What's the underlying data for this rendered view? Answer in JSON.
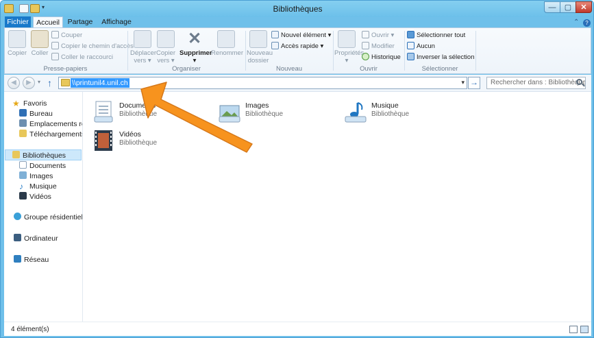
{
  "window": {
    "title": "Bibliothèques",
    "controls": {
      "minimize": "—",
      "maximize": "▢",
      "close": "✕"
    }
  },
  "ribbon": {
    "tabs": [
      {
        "label": "Fichier"
      },
      {
        "label": "Accueil"
      },
      {
        "label": "Partage"
      },
      {
        "label": "Affichage"
      }
    ],
    "groups": {
      "clipboard": {
        "label": "Presse-papiers",
        "copy": "Copier",
        "paste": "Coller",
        "cut": "Couper",
        "copy_path": "Copier le chemin d'accès",
        "paste_shortcut": "Coller le raccourci"
      },
      "organize": {
        "label": "Organiser",
        "move_to_l1": "Déplacer",
        "move_to_l2": "vers ▾",
        "copy_to_l1": "Copier",
        "copy_to_l2": "vers ▾",
        "delete": "Supprimer",
        "delete_arrow": "▾",
        "rename": "Renommer"
      },
      "new": {
        "label": "Nouveau",
        "new_folder_l1": "Nouveau",
        "new_folder_l2": "dossier",
        "new_item": "Nouvel élément ▾",
        "easy_access": "Accès rapide ▾"
      },
      "open": {
        "label": "Ouvrir",
        "properties": "Propriétés",
        "properties_arrow": "▾",
        "open": "Ouvrir ▾",
        "edit": "Modifier",
        "history": "Historique"
      },
      "select": {
        "label": "Sélectionner",
        "select_all": "Sélectionner tout",
        "select_none": "Aucun",
        "invert": "Inverser la sélection"
      }
    }
  },
  "address": {
    "value": "\\\\printunil4.unil.ch",
    "search_placeholder": "Rechercher dans : Bibliothèques"
  },
  "nav_pane": {
    "favorites": "Favoris",
    "desktop": "Bureau",
    "recent": "Emplacements récents",
    "downloads": "Téléchargements",
    "libraries": "Bibliothèques",
    "documents": "Documents",
    "images": "Images",
    "music": "Musique",
    "videos": "Vidéos",
    "homegroup": "Groupe résidentiel",
    "computer": "Ordinateur",
    "network": "Réseau"
  },
  "libraries": [
    {
      "name": "Documents",
      "type": "Bibliothèque",
      "icon": "documents-library-icon"
    },
    {
      "name": "Images",
      "type": "Bibliothèque",
      "icon": "images-library-icon"
    },
    {
      "name": "Musique",
      "type": "Bibliothèque",
      "icon": "music-library-icon"
    },
    {
      "name": "Vidéos",
      "type": "Bibliothèque",
      "icon": "videos-library-icon"
    }
  ],
  "status": {
    "count": "4 élément(s)"
  },
  "colors": {
    "titlebar": "#6cc0ea",
    "file_tab": "#1979ca",
    "selection": "#3399ff",
    "annotation_arrow": "#f7931e"
  }
}
